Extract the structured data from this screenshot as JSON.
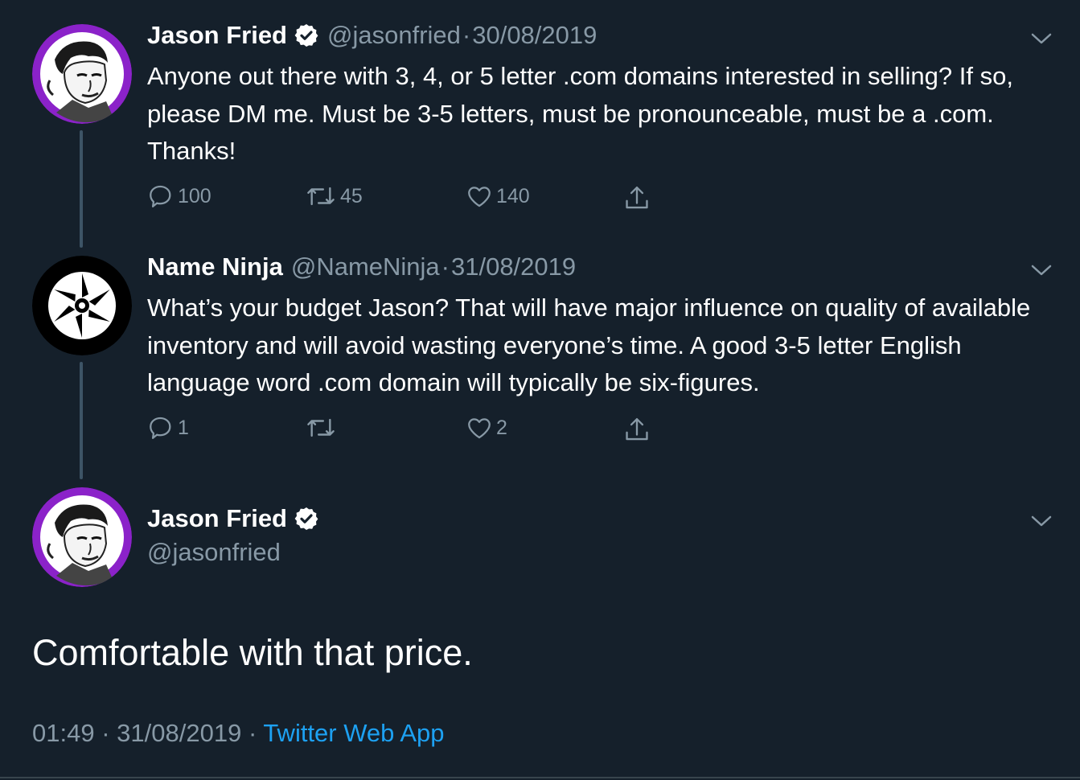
{
  "colors": {
    "background": "#15202b",
    "secondary_text": "#8899a6",
    "link": "#1da1f2",
    "avatar_purple": "#8b22c9"
  },
  "tweets": [
    {
      "name": "Jason Fried",
      "verified": true,
      "handle": "@jasonfried",
      "date": "30/08/2019",
      "text": "Anyone out there with 3, 4, or 5 letter .com domains interested in selling? If so, please DM me. Must be 3-5 letters, must be pronounceable, must be a .com. Thanks!",
      "replies": "100",
      "retweets": "45",
      "likes": "140"
    },
    {
      "name": "Name Ninja",
      "verified": false,
      "handle": "@NameNinja",
      "date": "31/08/2019",
      "text": "What’s your budget Jason? That will have major influence on quality of available inventory and will avoid wasting everyone’s time. A good 3-5 letter English language word .com domain will typically be six-figures.",
      "replies": "1",
      "retweets": "",
      "likes": "2"
    }
  ],
  "main_tweet": {
    "name": "Jason Fried",
    "verified": true,
    "handle": "@jasonfried",
    "text": "Comfortable with that price.",
    "time": "01:49",
    "date": "31/08/2019",
    "source": "Twitter Web App",
    "separator": "·"
  },
  "icons": [
    "reply-icon",
    "retweet-icon",
    "like-icon",
    "share-icon",
    "chevron-down-icon",
    "verified-badge-icon"
  ]
}
